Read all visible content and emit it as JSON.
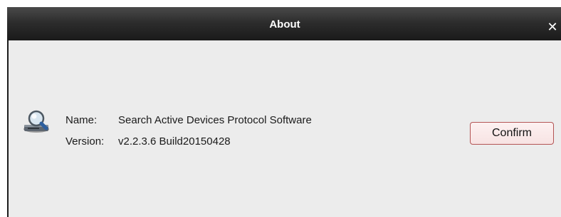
{
  "dialog": {
    "title": "About",
    "close_symbol": "✕",
    "close_icon": "close-icon",
    "app_icon": "search-devices-icon"
  },
  "info": {
    "name_label": "Name:",
    "name_value": "Search Active Devices Protocol Software",
    "version_label": "Version:",
    "version_value": "v2.2.3.6 Build20150428"
  },
  "buttons": {
    "confirm_label": "Confirm"
  },
  "colors": {
    "title_bar": "#2d2d2d",
    "dialog_bg": "#ececec",
    "confirm_border": "#b35454"
  }
}
